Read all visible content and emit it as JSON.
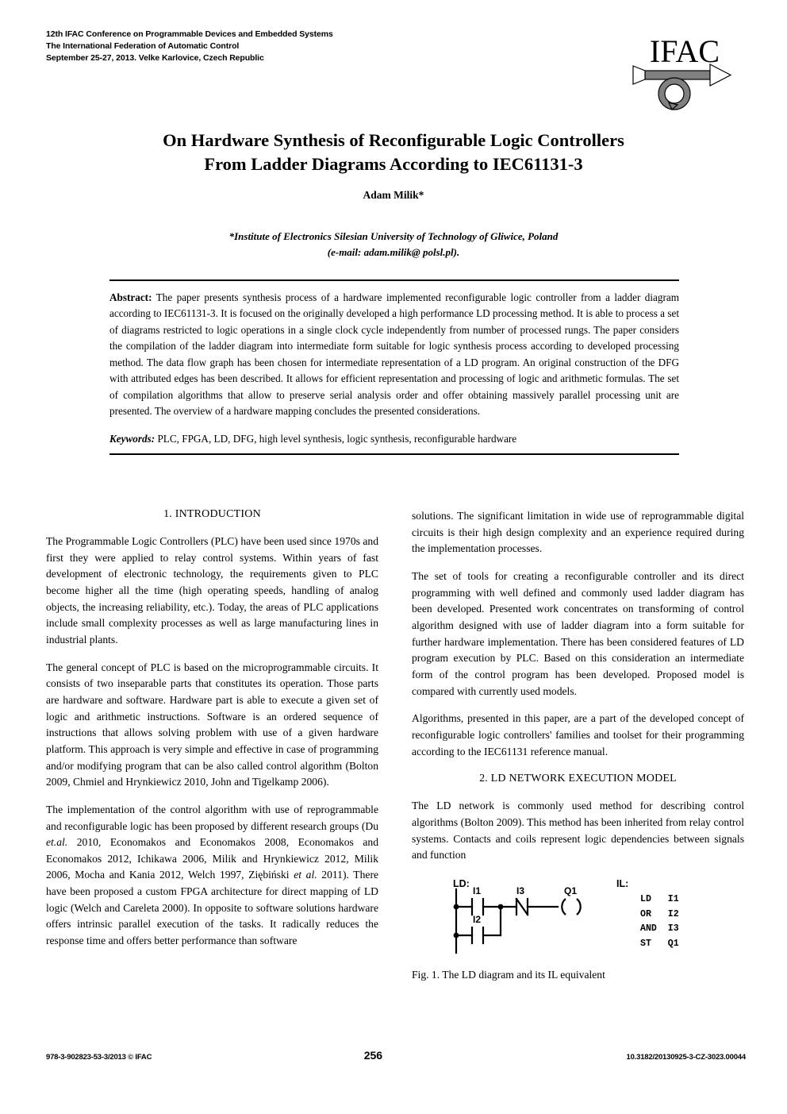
{
  "header": {
    "conference_lines": [
      "12th IFAC Conference on Programmable Devices and Embedded Systems",
      "The International Federation of Automatic Control",
      "September 25-27, 2013. Velke Karlovice, Czech Republic"
    ],
    "logo_text": "IFAC"
  },
  "title": {
    "line1": "On Hardware Synthesis of Reconfigurable Logic Controllers",
    "line2": "From Ladder Diagrams According to IEC61131-3"
  },
  "author": "Adam Milik*",
  "affiliation": {
    "line1": "*Institute of Electronics Silesian University of Technology of Gliwice, Poland",
    "line2": "(e-mail: adam.milik@ polsl.pl)."
  },
  "abstract": {
    "label": "Abstract:",
    "text": " The paper presents synthesis process of a hardware implemented reconfigurable logic controller from a ladder diagram according to IEC61131-3. It is focused on the originally developed a high performance LD processing method. It is able to process a set of diagrams restricted to logic operations in a single clock cycle independently from number of processed rungs. The paper considers the compilation of the ladder diagram into intermediate form suitable for logic synthesis process according to developed processing method. The data flow graph has been chosen for intermediate representation of a LD program. An original construction of the DFG with attributed edges has been described. It allows for efficient representation and processing of logic and arithmetic formulas. The set of compilation algorithms that allow to preserve serial analysis order and offer obtaining massively parallel processing unit are presented. The overview of a hardware mapping concludes the presented considerations."
  },
  "keywords": {
    "label": "Keywords:",
    "text": " PLC, FPGA, LD, DFG, high level synthesis, logic synthesis, reconfigurable hardware"
  },
  "sections": {
    "introduction_heading": "1. INTRODUCTION",
    "ld_network_heading": "2. LD NETWORK EXECUTION MODEL"
  },
  "left_column": {
    "p1": "The Programmable Logic Controllers (PLC) have been used since 1970s and first they were applied to relay control systems. Within years of fast development of electronic technology, the requirements given to PLC become higher all the time (high operating speeds, handling of analog objects, the increasing reliability, etc.). Today, the areas of PLC applications include small complexity processes as well as large manufacturing lines in industrial plants.",
    "p2": "The general concept of PLC is based on the microprogrammable circuits. It consists of two inseparable parts that constitutes its operation. Those parts are hardware and software. Hardware part is able to execute a given set of logic and arithmetic instructions. Software is an ordered sequence of instructions that allows solving problem with use of a given hardware platform. This approach is very simple and effective in case of programming and/or modifying program that can be also called control algorithm (Bolton 2009, Chmiel and Hrynkiewicz 2010, John and Tigelkamp 2006).",
    "p3_a": "The implementation of the control algorithm with use of reprogrammable and reconfigurable logic has been proposed by different research groups (Du ",
    "p3_italic1": "et.al.",
    "p3_b": " 2010, Economakos and Economakos 2008, Economakos and Economakos 2012, Ichikawa 2006, Milik and Hrynkiewicz 2012, Milik 2006, Mocha and Kania 2012, Welch 1997, Ziębiński ",
    "p3_italic2": "et al.",
    "p3_c": " 2011). There have been proposed a custom FPGA architecture for direct mapping of LD logic (Welch and Careleta 2000). In opposite to software solutions hardware offers intrinsic parallel execution of the tasks. It radically reduces the response time and offers better performance than software"
  },
  "right_column": {
    "p1": "solutions. The significant limitation in wide use of reprogrammable digital circuits is their high design complexity and an experience required during the implementation processes.",
    "p2": "The set of tools for creating a reconfigurable controller and its direct programming with well defined and commonly used ladder diagram has been developed. Presented work concentrates on transforming of control algorithm designed with use of ladder diagram into a form suitable for further hardware implementation. There has been considered features of LD program execution by PLC. Based on this consideration an intermediate form of the control program has been developed. Proposed model is compared with currently used models.",
    "p3": "Algorithms, presented in this paper, are a part of the developed concept of reconfigurable logic controllers' families and toolset for their programming according to the IEC61131 reference manual.",
    "p4": "The LD network is commonly used method for describing control algorithms (Bolton 2009). This method has been inherited from relay control systems. Contacts and coils represent logic dependencies between signals and function"
  },
  "figure": {
    "ld_label": "LD:",
    "il_label": "IL:",
    "contacts": {
      "i1": "I1",
      "i2": "I2",
      "i3": "I3",
      "q1": "Q1"
    },
    "il_code": "LD   I1\nOR   I2\nAND  I3\nST   Q1",
    "caption": "Fig. 1. The LD diagram and its IL equivalent"
  },
  "footer": {
    "isbn": "978-3-902823-53-3/2013 © IFAC",
    "page_number": "256",
    "doi": "10.3182/20130925-3-CZ-3023.00044"
  },
  "colors": {
    "text": "#000000",
    "background": "#ffffff",
    "logo_gray": "#808080"
  }
}
